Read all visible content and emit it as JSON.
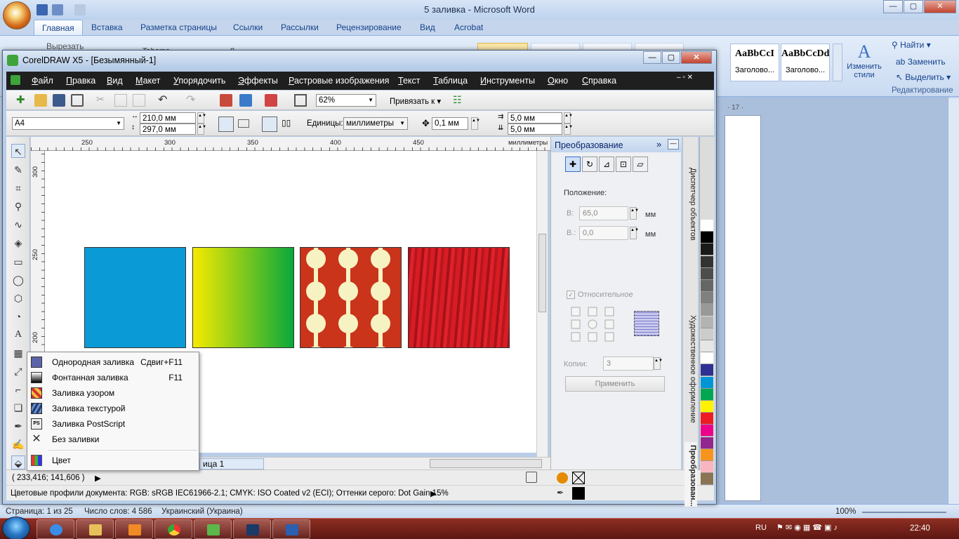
{
  "word": {
    "title": "5 заливка - Microsoft Word",
    "tabs": [
      "Главная",
      "Вставка",
      "Разметка страницы",
      "Ссылки",
      "Рассылки",
      "Рецензирование",
      "Вид",
      "Acrobat"
    ],
    "ribbon": {
      "cut_label": "Вырезать",
      "font_name": "Tahoma",
      "font_size": "8",
      "styles": [
        {
          "sample": "AaBbCcI",
          "name": "Заголово..."
        },
        {
          "sample": "AaBbCcDd",
          "name": "Заголово..."
        }
      ],
      "change_styles": "Изменить стили",
      "find": "Найти",
      "replace": "Заменить",
      "select": "Выделить",
      "editing_group": "Редактирование"
    },
    "ruler_mark": "· 17 ·",
    "status": {
      "page": "Страница: 1 из 25",
      "words": "Число слов: 4 586",
      "language": "Украинский (Украина)",
      "zoom": "100%"
    }
  },
  "corel": {
    "title": "CorelDRAW X5 - [Безымянный-1]",
    "menu": [
      {
        "label": "Файл",
        "key": "Ф",
        "rest": "айл"
      },
      {
        "label": "Правка",
        "key": "П",
        "rest": "равка"
      },
      {
        "label": "Вид",
        "key": "В",
        "rest": "ид"
      },
      {
        "label": "Макет",
        "key": "М",
        "rest": "акет"
      },
      {
        "label": "Упорядочить",
        "key": "У",
        "rest": "порядочить"
      },
      {
        "label": "Эффекты",
        "key": "Э",
        "rest": "ффекты"
      },
      {
        "label": "Растровые изображения",
        "key": "Р",
        "rest": "астровые изображения"
      },
      {
        "label": "Текст",
        "key": "Т",
        "rest": "екст"
      },
      {
        "label": "Таблица",
        "key": "Т",
        "rest": "аблица"
      },
      {
        "label": "Инструменты",
        "key": "И",
        "rest": "нструменты"
      },
      {
        "label": "Окно",
        "key": "О",
        "rest": "кно"
      },
      {
        "label": "Справка",
        "key": "С",
        "rest": "правка"
      }
    ],
    "toolbar": {
      "zoom": "62%",
      "snap_label": "Привязать к"
    },
    "property_bar": {
      "page_size": "A4",
      "width": "210,0 мм",
      "height": "297,0 мм",
      "units_label": "Единицы:",
      "units_value": "миллиметры",
      "nudge": "0,1 мм",
      "dup_x": "5,0 мм",
      "dup_y": "5,0 мм"
    },
    "ruler": {
      "h_ticks": [
        "250",
        "300",
        "350",
        "400",
        "450"
      ],
      "h_unit": "миллиметры",
      "v_ticks": [
        "300",
        "250",
        "200"
      ]
    },
    "swatches": [
      {
        "name": "uniform",
        "color": "#0a9bd6"
      },
      {
        "name": "fountain",
        "from": "#f6ea00",
        "to": "#09a83a"
      },
      {
        "name": "pattern",
        "bg": "#c9341b",
        "fg": "#f7f2c2"
      },
      {
        "name": "texture",
        "color": "#c81a1f"
      }
    ],
    "page_tab": "ица 1",
    "status": {
      "coords": "( 233,416; 141,606 )",
      "profiles": "Цветовые профили документа: RGB: sRGB IEC61966-2.1; CMYK: ISO Coated v2 (ECI); Оттенки серого: Dot Gain 15%"
    },
    "docker": {
      "title": "Преобразование",
      "position_label": "Положение:",
      "h_label": "В:",
      "h_value": "65,0",
      "v_label": "В.:",
      "v_value": "0,0",
      "unit": "мм",
      "relative_label": "Относительное",
      "copies_label": "Копии:",
      "copies_value": "3",
      "apply_label": "Применить",
      "tabs": [
        "Диспетчер объектов",
        "Художественное оформление",
        "Преобразован..."
      ]
    },
    "palette": [
      "#ffffff",
      "#000000",
      "#1a1a1a",
      "#333333",
      "#4d4d4d",
      "#666666",
      "#808080",
      "#999999",
      "#b3b3b3",
      "#cccccc",
      "#e6e6e6",
      "#ffffff",
      "#2e3192",
      "#0096d6",
      "#00a651",
      "#fff200",
      "#ed1c24",
      "#ec008c",
      "#92278f",
      "#f7941d",
      "#f9b6c1",
      "#8b7355"
    ],
    "context_menu": [
      {
        "label": "Однородная заливка",
        "shortcut": "Сдвиг+F11",
        "icon": "uniform-fill-icon"
      },
      {
        "label": "Фонтанная заливка",
        "shortcut": "F11",
        "icon": "fountain-fill-icon"
      },
      {
        "label": "Заливка узором",
        "shortcut": "",
        "icon": "pattern-fill-icon"
      },
      {
        "label": "Заливка текстурой",
        "shortcut": "",
        "icon": "texture-fill-icon"
      },
      {
        "label": "Заливка PostScript",
        "shortcut": "",
        "icon": "postscript-fill-icon"
      },
      {
        "label": "Без заливки",
        "shortcut": "",
        "icon": "no-fill-icon"
      },
      {
        "label": "Цвет",
        "shortcut": "",
        "icon": "color-docker-icon"
      }
    ]
  },
  "taskbar": {
    "language": "RU",
    "time": "22:40"
  }
}
